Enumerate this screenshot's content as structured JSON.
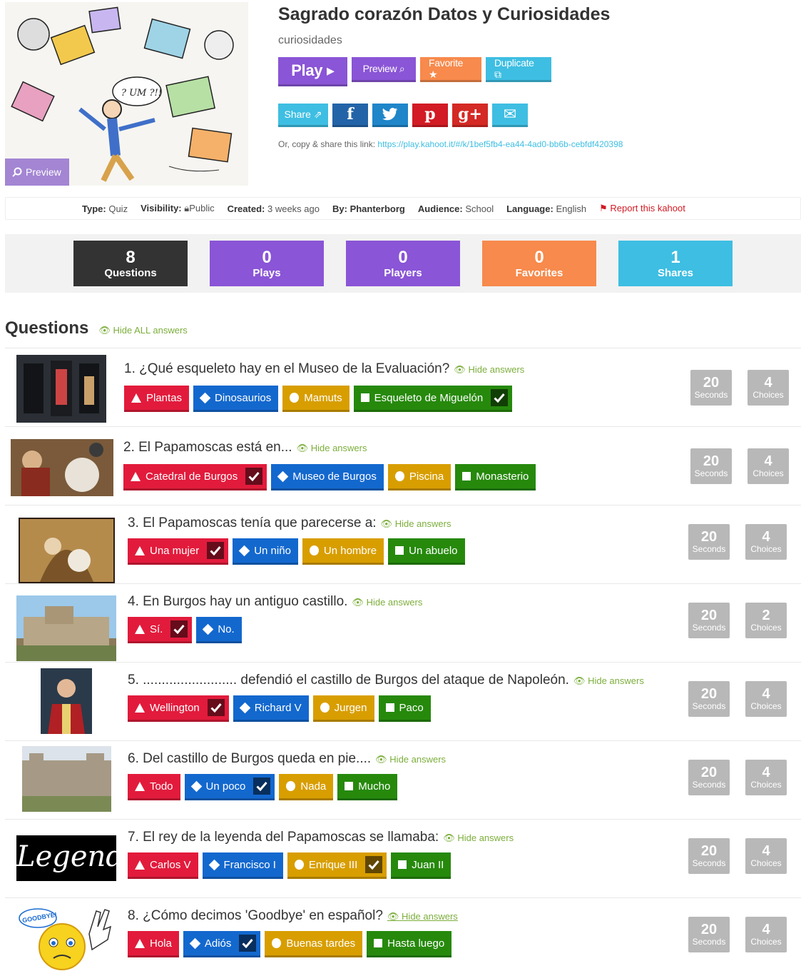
{
  "kahoot": {
    "title": "Sagrado corazón Datos y Curiosidades",
    "subtitle": "curiosidades",
    "cover_preview_label": "Preview"
  },
  "actions": {
    "play": "Play ▸",
    "preview": "Preview ⌕",
    "favorite": "Favorite ★",
    "duplicate": "Duplicate ⧉"
  },
  "share": {
    "share_label": "Share ⇗",
    "facebook": "f",
    "twitter": "🐦",
    "pinterest": "p",
    "googleplus": "g+",
    "email": "✉",
    "copy_prefix": "Or, copy & share this link:",
    "link": "https://play.kahoot.it/#/k/1bef5fb4-ea44-4ad0-bb6b-cebfdf420398"
  },
  "meta": {
    "type_label": "Type:",
    "type_value": "Quiz",
    "visibility_label": "Visibility:",
    "visibility_value": "Public",
    "created_label": "Created:",
    "created_value": "3 weeks ago",
    "by_label": "By:",
    "by_value": "Phanterborg",
    "audience_label": "Audience:",
    "audience_value": "School",
    "language_label": "Language:",
    "language_value": "English",
    "report": "Report this kahoot"
  },
  "stats": [
    {
      "num": "8",
      "label": "Questions"
    },
    {
      "num": "0",
      "label": "Plays"
    },
    {
      "num": "0",
      "label": "Players"
    },
    {
      "num": "0",
      "label": "Favorites"
    },
    {
      "num": "1",
      "label": "Shares"
    }
  ],
  "questions_header": {
    "title": "Questions",
    "hide_all": "Hide ALL answers"
  },
  "hide_answers_label": "Hide answers",
  "questions": [
    {
      "text": "1. ¿Qué esqueleto hay en el Museo de la Evaluación?",
      "seconds": "20",
      "seconds_label": "Seconds",
      "choices": "4",
      "choices_label": "Choices",
      "answers": [
        "Plantas",
        "Dinosaurios",
        "Mamuts",
        "Esqueleto de Miguelón"
      ]
    },
    {
      "text": "2. El Papamoscas está en...",
      "seconds": "20",
      "seconds_label": "Seconds",
      "choices": "4",
      "choices_label": "Choices",
      "answers": [
        "Catedral de Burgos",
        "Museo de Burgos",
        "Piscina",
        "Monasterio"
      ]
    },
    {
      "text": "3. El Papamoscas tenía que parecerse a:",
      "seconds": "20",
      "seconds_label": "Seconds",
      "choices": "4",
      "choices_label": "Choices",
      "answers": [
        "Una mujer",
        "Un niño",
        "Un hombre",
        "Un abuelo"
      ]
    },
    {
      "text": "4. En Burgos hay un antiguo castillo.",
      "seconds": "20",
      "seconds_label": "Seconds",
      "choices": "2",
      "choices_label": "Choices",
      "answers": [
        "Sí.",
        "No."
      ]
    },
    {
      "text": "5. ......................... defendió el castillo de Burgos del ataque de Napoleón.",
      "seconds": "20",
      "seconds_label": "Seconds",
      "choices": "4",
      "choices_label": "Choices",
      "answers": [
        "Wellington",
        "Richard V",
        "Jurgen",
        "Paco"
      ]
    },
    {
      "text": "6. Del castillo de Burgos queda en pie....",
      "seconds": "20",
      "seconds_label": "Seconds",
      "choices": "4",
      "choices_label": "Choices",
      "answers": [
        "Todo",
        "Un poco",
        "Nada",
        "Mucho"
      ]
    },
    {
      "text": "7. El rey de la leyenda del Papamoscas se llamaba:",
      "seconds": "20",
      "seconds_label": "Seconds",
      "choices": "4",
      "choices_label": "Choices",
      "answers": [
        "Carlos V",
        "Francisco I",
        "Enrique III",
        "Juan II"
      ]
    },
    {
      "text": "8. ¿Cómo decimos 'Goodbye' en español?",
      "seconds": "20",
      "seconds_label": "Seconds",
      "choices": "4",
      "choices_label": "Choices",
      "answers": [
        "Hola",
        "Adiós",
        "Buenas tardes",
        "Hasta luego"
      ]
    }
  ],
  "thumb_text": {
    "legend": "Legend",
    "goodbye": "GOODBYE!",
    "um": "? UM ?!!"
  },
  "colors": {
    "red": "#e21b3c",
    "blue": "#1368ce",
    "yellow": "#d89e00",
    "green": "#26890c",
    "purple": "#8a55d6",
    "orange": "#f78a4c",
    "cyan": "#3ebee2",
    "dark": "#333333"
  }
}
